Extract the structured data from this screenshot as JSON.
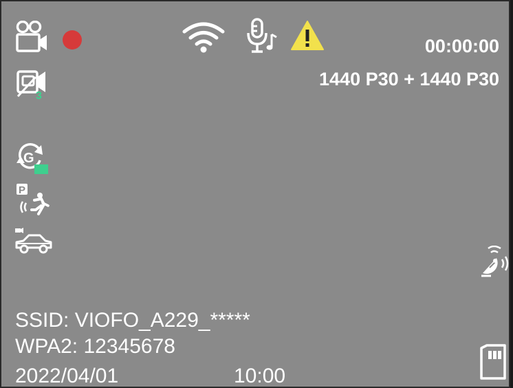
{
  "status": {
    "timer": "00:00:00",
    "resolution": "1440 P30 + 1440 P30",
    "recording_color": "#d63a3a",
    "warning_color": "#f2e14c",
    "accent_green": "#3ecf8e"
  },
  "wifi": {
    "ssid": "SSID: VIOFO_A229_*****",
    "password": "WPA2: 12345678"
  },
  "datetime": {
    "date": "2022/04/01",
    "time": "10:00"
  },
  "icons": [
    "camera-mode-icon",
    "recording-indicator",
    "wifi-icon",
    "microphone-music-icon",
    "warning-icon",
    "multi-cam-icon",
    "g-sensor-icon",
    "parking-motion-icon",
    "car-icon",
    "gps-icon",
    "sd-card-icon"
  ]
}
